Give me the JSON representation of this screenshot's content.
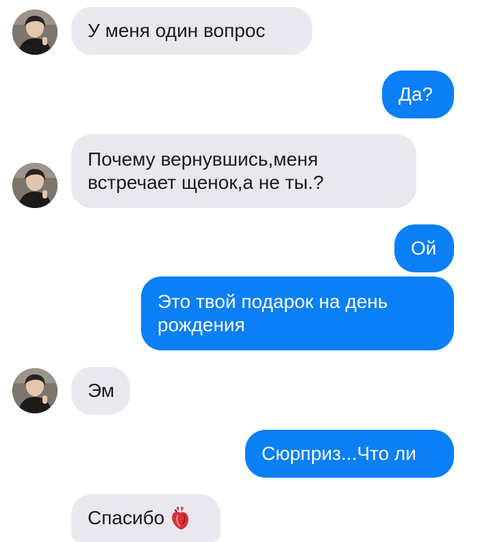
{
  "colors": {
    "incoming_bubble": "#e9e8ee",
    "outgoing_bubble": "#0b7ff5",
    "incoming_text": "#1c1c1e",
    "outgoing_text": "#ffffff"
  },
  "messages": [
    {
      "direction": "incoming",
      "text": "У меня один вопрос",
      "avatar": "contact-avatar"
    },
    {
      "direction": "outgoing",
      "text": "Да?"
    },
    {
      "direction": "incoming",
      "lines": [
        "Почему вернувшись,меня",
        "встречает щенок,а не ты.?"
      ],
      "avatar": "contact-avatar"
    },
    {
      "direction": "outgoing",
      "text": "Ой"
    },
    {
      "direction": "outgoing",
      "lines": [
        "Это твой подарок на день",
        "рождения"
      ]
    },
    {
      "direction": "incoming",
      "text": "Эм",
      "avatar": "contact-avatar"
    },
    {
      "direction": "outgoing",
      "text": "Сюрприз...Что ли"
    },
    {
      "direction": "incoming",
      "text": "Спасибо",
      "emoji": "anatomical-heart-icon"
    }
  ]
}
